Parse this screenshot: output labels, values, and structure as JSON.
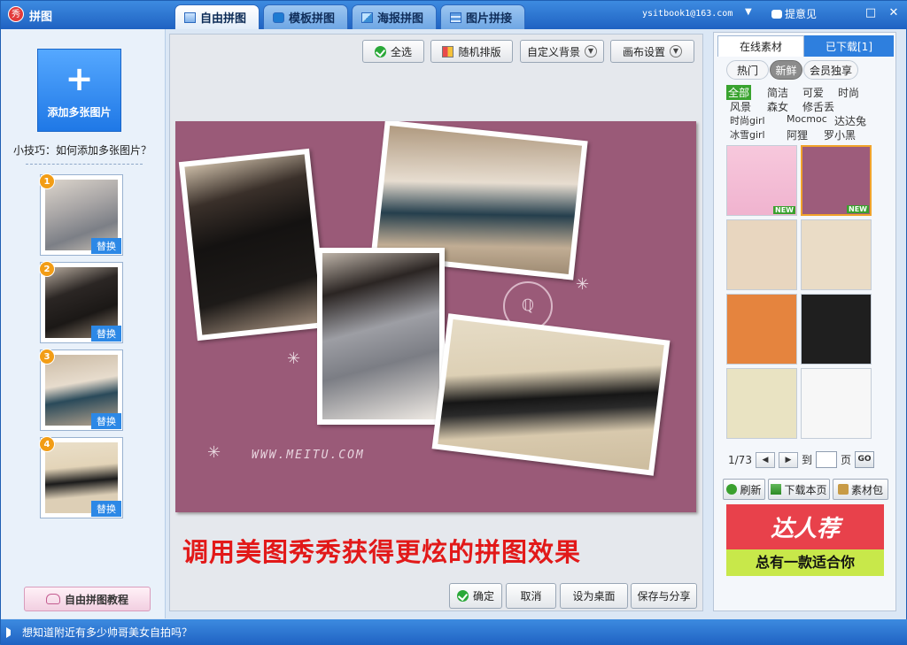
{
  "window": {
    "title": "拼图",
    "logo_text": "秀",
    "tabs": [
      {
        "label": "自由拼图",
        "icon": "free-collage-icon",
        "active": true
      },
      {
        "label": "模板拼图",
        "icon": "template-collage-icon",
        "active": false
      },
      {
        "label": "海报拼图",
        "icon": "poster-collage-icon",
        "active": false
      },
      {
        "label": "图片拼接",
        "icon": "image-stitch-icon",
        "active": false
      }
    ],
    "user_email": "ysitbook1@163.com",
    "feedback_label": "提意见",
    "controls": {
      "restore": "□",
      "close": "✕"
    }
  },
  "sidebar": {
    "add_label": "添加多张图片",
    "add_symbol": "+",
    "tip": "小技巧：如何添加多张图片？",
    "thumbnails": [
      {
        "number": "1",
        "replace_label": "替换"
      },
      {
        "number": "2",
        "replace_label": "替换"
      },
      {
        "number": "3",
        "replace_label": "替换"
      },
      {
        "number": "4",
        "replace_label": "替换"
      }
    ],
    "tutorial_label": "自由拼图教程"
  },
  "toolbar": {
    "select_all": "全选",
    "random_layout": "随机排版",
    "custom_background": "自定义背景",
    "canvas_settings": "画布设置"
  },
  "canvas": {
    "background_color": "#9a5a78",
    "watermark": "WWW.MEITU.COM",
    "stamp": "ℚ"
  },
  "promo_text": "调用美图秀秀获得更炫的拼图效果",
  "actions": {
    "confirm": "确定",
    "cancel": "取消",
    "set_desktop": "设为桌面",
    "save_share": "保存与分享"
  },
  "materials": {
    "tabs": {
      "online": "在线素材",
      "downloaded": "已下载[1]"
    },
    "filters": [
      "热门",
      "新鲜",
      "会员独享"
    ],
    "active_filter": "新鲜",
    "categories": [
      "全部",
      "简洁",
      "可爱",
      "时尚",
      "风景",
      "森女",
      "修舌丢",
      "时尚girl",
      "Mocmoc",
      "达达兔",
      "冰雪girl",
      "阿狸",
      "罗小黑"
    ],
    "active_category": "全部",
    "new_tag": "NEW",
    "pager": {
      "current": "1/73",
      "to_label": "到",
      "page_label": "页",
      "go": "GO"
    },
    "buttons": {
      "refresh": "刷新",
      "download_page": "下载本页",
      "material_pack": "素材包"
    },
    "ad": {
      "title": "达人荐",
      "subtitle": "总有一款适合你"
    }
  },
  "status": {
    "message": "想知道附近有多少帅哥美女自拍吗？"
  },
  "colors": {
    "accent": "#2e7fde",
    "promo": "#e21919",
    "selected": "#f1a32b",
    "new_tag": "#3aa02e"
  }
}
